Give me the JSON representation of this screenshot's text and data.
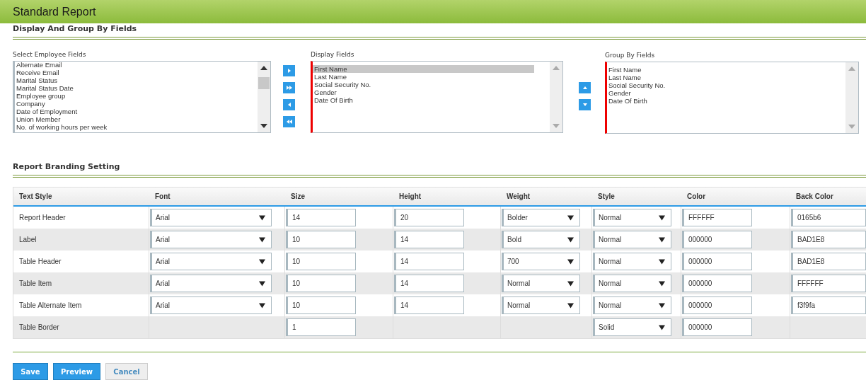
{
  "title": "Standard Report",
  "display_section": {
    "heading": "Display And Group By Fields",
    "employee_fields": {
      "label": "Select Employee Fields",
      "items": [
        {
          "text": "Alternate Email",
          "selected": false
        },
        {
          "text": "Receive Email",
          "selected": false
        },
        {
          "text": "Marital Status",
          "selected": false
        },
        {
          "text": "Marital Status Date",
          "selected": false
        },
        {
          "text": "Employee group",
          "selected": false
        },
        {
          "text": "Company",
          "selected": false
        },
        {
          "text": "Date of Employment",
          "selected": false
        },
        {
          "text": "Union Member",
          "selected": false
        },
        {
          "text": "No. of working hours per week",
          "selected": false
        }
      ]
    },
    "display_fields": {
      "label": "Display Fields",
      "items": [
        {
          "text": "First Name",
          "selected": true
        },
        {
          "text": "Last Name",
          "selected": false
        },
        {
          "text": "Social Security No.",
          "selected": false
        },
        {
          "text": "Gender",
          "selected": false
        },
        {
          "text": "Date Of Birth",
          "selected": false
        }
      ]
    },
    "group_by_fields": {
      "label": "Group By Fields",
      "items": [
        {
          "text": "First Name",
          "selected": false
        },
        {
          "text": "Last Name",
          "selected": false
        },
        {
          "text": "Social Security No.",
          "selected": false
        },
        {
          "text": "Gender",
          "selected": false
        },
        {
          "text": "Date Of Birth",
          "selected": false
        }
      ]
    }
  },
  "branding_section": {
    "heading": "Report Branding Setting",
    "table": {
      "columns": [
        "Text Style",
        "Font",
        "Size",
        "Height",
        "Weight",
        "Style",
        "Color",
        "Back Color"
      ],
      "rows": [
        [
          {
            "kind": "text",
            "value": "Report Header"
          },
          {
            "kind": "select",
            "value": "Arial"
          },
          {
            "kind": "input",
            "value": "14"
          },
          {
            "kind": "input",
            "value": "20"
          },
          {
            "kind": "select",
            "value": "Bolder"
          },
          {
            "kind": "select",
            "value": "Normal"
          },
          {
            "kind": "input",
            "value": "FFFFFF"
          },
          {
            "kind": "input",
            "value": "0165b6"
          }
        ],
        [
          {
            "kind": "text",
            "value": "Label"
          },
          {
            "kind": "select",
            "value": "Arial"
          },
          {
            "kind": "input",
            "value": "10"
          },
          {
            "kind": "input",
            "value": "14"
          },
          {
            "kind": "select",
            "value": "Bold"
          },
          {
            "kind": "select",
            "value": "Normal"
          },
          {
            "kind": "input",
            "value": "000000"
          },
          {
            "kind": "input",
            "value": "BAD1E8"
          }
        ],
        [
          {
            "kind": "text",
            "value": "Table Header"
          },
          {
            "kind": "select",
            "value": "Arial"
          },
          {
            "kind": "input",
            "value": "10"
          },
          {
            "kind": "input",
            "value": "14"
          },
          {
            "kind": "select",
            "value": "700"
          },
          {
            "kind": "select",
            "value": "Normal"
          },
          {
            "kind": "input",
            "value": "000000"
          },
          {
            "kind": "input",
            "value": "BAD1E8"
          }
        ],
        [
          {
            "kind": "text",
            "value": "Table Item"
          },
          {
            "kind": "select",
            "value": "Arial"
          },
          {
            "kind": "input",
            "value": "10"
          },
          {
            "kind": "input",
            "value": "14"
          },
          {
            "kind": "select",
            "value": "Normal"
          },
          {
            "kind": "select",
            "value": "Normal"
          },
          {
            "kind": "input",
            "value": "000000"
          },
          {
            "kind": "input",
            "value": "FFFFFF"
          }
        ],
        [
          {
            "kind": "text",
            "value": "Table Alternate Item"
          },
          {
            "kind": "select",
            "value": "Arial"
          },
          {
            "kind": "input",
            "value": "10"
          },
          {
            "kind": "input",
            "value": "14"
          },
          {
            "kind": "select",
            "value": "Normal"
          },
          {
            "kind": "select",
            "value": "Normal"
          },
          {
            "kind": "input",
            "value": "000000"
          },
          {
            "kind": "input",
            "value": "f3f9fa"
          }
        ],
        [
          {
            "kind": "text",
            "value": "Table Border"
          },
          {
            "kind": "empty"
          },
          {
            "kind": "input",
            "value": "1"
          },
          {
            "kind": "empty"
          },
          {
            "kind": "empty"
          },
          {
            "kind": "select",
            "value": "Solid"
          },
          {
            "kind": "input",
            "value": "000000"
          },
          {
            "kind": "empty"
          }
        ]
      ]
    }
  },
  "buttons": [
    {
      "label": "Save",
      "kind": "primary"
    },
    {
      "label": "Preview",
      "kind": "primary"
    },
    {
      "label": "Cancel",
      "kind": "secondary"
    }
  ]
}
